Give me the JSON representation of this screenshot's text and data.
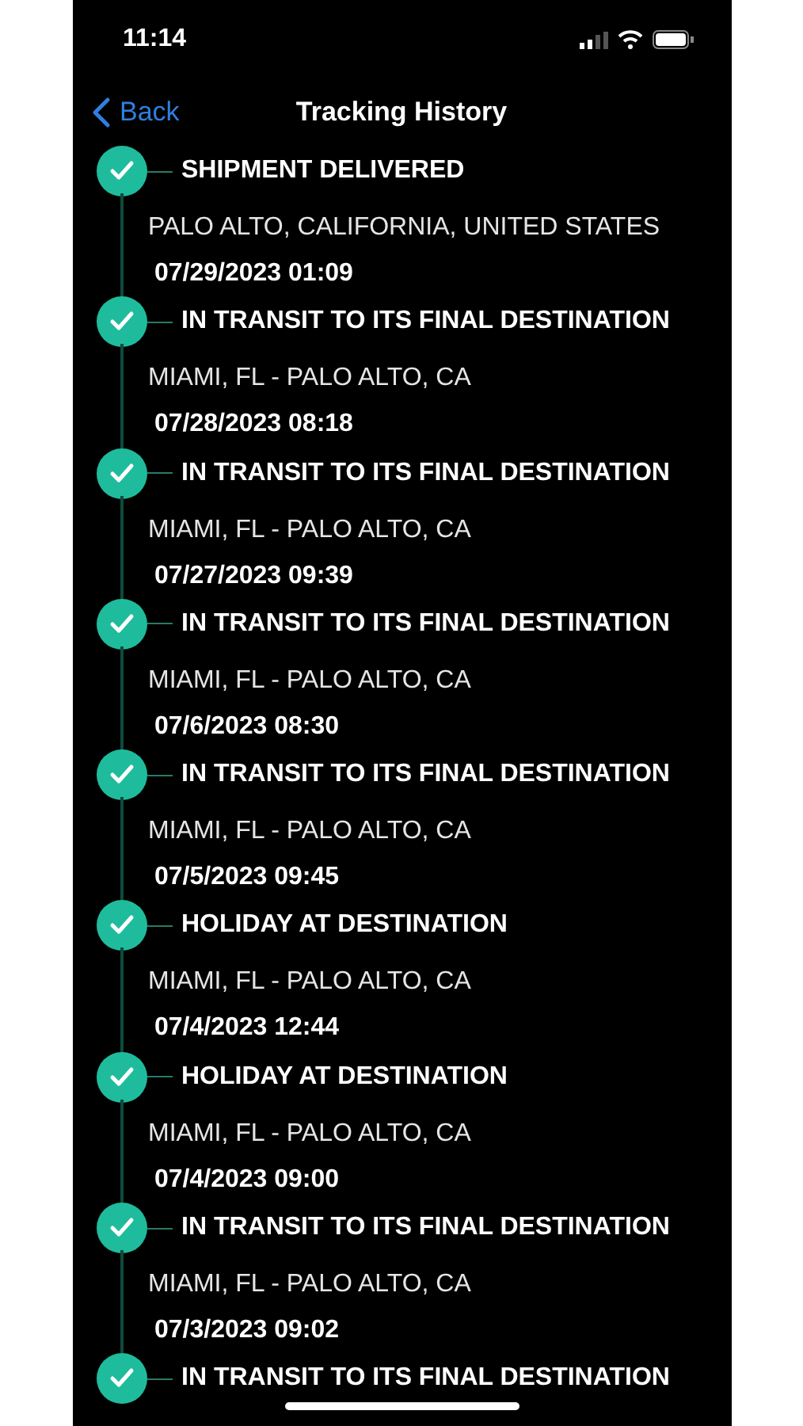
{
  "status_bar": {
    "time": "11:14"
  },
  "nav": {
    "back": "Back",
    "title": "Tracking History"
  },
  "events": [
    {
      "title": "SHIPMENT DELIVERED",
      "location": "PALO ALTO, CALIFORNIA, UNITED STATES",
      "datetime": "07/29/2023 01:09",
      "done": true
    },
    {
      "title": "IN TRANSIT TO ITS FINAL DESTINATION",
      "location": "MIAMI, FL - PALO ALTO, CA",
      "datetime": "07/28/2023 08:18",
      "done": true
    },
    {
      "title": "IN TRANSIT TO ITS FINAL DESTINATION",
      "location": "MIAMI, FL - PALO ALTO, CA",
      "datetime": "07/27/2023 09:39",
      "done": true
    },
    {
      "title": "IN TRANSIT TO ITS FINAL DESTINATION",
      "location": "MIAMI, FL - PALO ALTO, CA",
      "datetime": "07/6/2023 08:30",
      "done": true
    },
    {
      "title": "IN TRANSIT TO ITS FINAL DESTINATION",
      "location": "MIAMI, FL - PALO ALTO, CA",
      "datetime": "07/5/2023 09:45",
      "done": true
    },
    {
      "title": "HOLIDAY AT DESTINATION",
      "location": "MIAMI, FL - PALO ALTO, CA",
      "datetime": "07/4/2023 12:44",
      "done": true
    },
    {
      "title": "HOLIDAY AT DESTINATION",
      "location": "MIAMI, FL - PALO ALTO, CA",
      "datetime": "07/4/2023 09:00",
      "done": true
    },
    {
      "title": "IN TRANSIT TO ITS FINAL DESTINATION",
      "location": "MIAMI, FL - PALO ALTO, CA",
      "datetime": "07/3/2023 09:02",
      "done": true
    },
    {
      "title": "IN TRANSIT TO ITS FINAL DESTINATION",
      "done": true
    }
  ]
}
